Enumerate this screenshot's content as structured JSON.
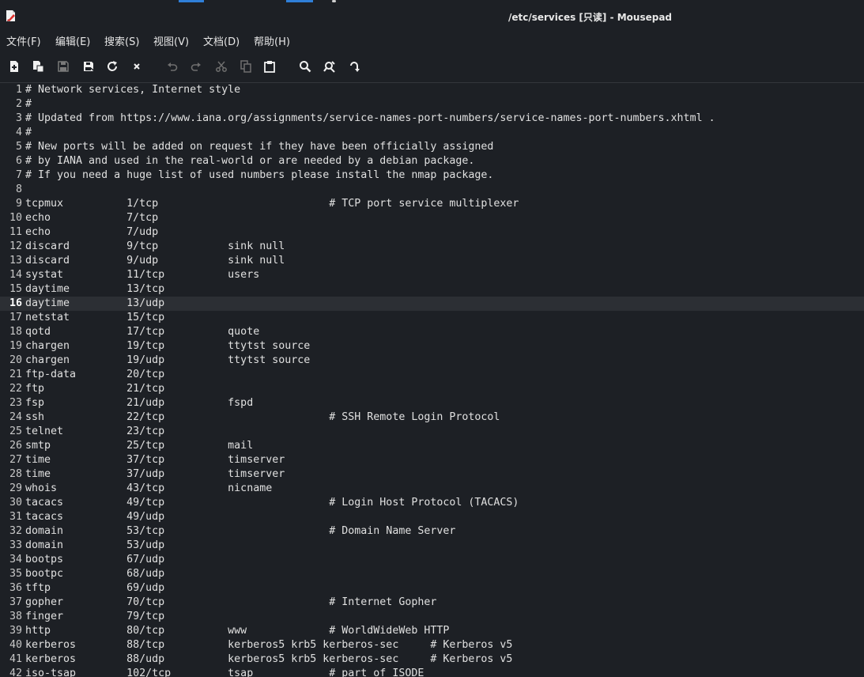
{
  "window": {
    "title": "/etc/services [只读] - Mousepad"
  },
  "menu": [
    {
      "label": "文件(F)"
    },
    {
      "label": "编辑(E)"
    },
    {
      "label": "搜索(S)"
    },
    {
      "label": "视图(V)"
    },
    {
      "label": "文档(D)"
    },
    {
      "label": "帮助(H)"
    }
  ],
  "toolbar": {
    "buttons": [
      {
        "icon": "new-document-icon"
      },
      {
        "icon": "new-window-icon"
      },
      {
        "icon": "save-icon"
      },
      {
        "icon": "save-as-icon"
      },
      {
        "icon": "reload-icon"
      },
      {
        "icon": "close-icon"
      },
      {
        "icon": "undo-icon"
      },
      {
        "icon": "redo-icon"
      },
      {
        "icon": "cut-icon"
      },
      {
        "icon": "copy-icon"
      },
      {
        "icon": "paste-icon"
      },
      {
        "icon": "search-icon"
      },
      {
        "icon": "find-replace-icon"
      },
      {
        "icon": "go-to-line-icon"
      }
    ]
  },
  "editor": {
    "current_line": 16,
    "lines": [
      {
        "n": "1",
        "text": "# Network services, Internet style"
      },
      {
        "n": "2",
        "text": "#"
      },
      {
        "n": "3",
        "text": "# Updated from https://www.iana.org/assignments/service-names-port-numbers/service-names-port-numbers.xhtml ."
      },
      {
        "n": "4",
        "text": "#"
      },
      {
        "n": "5",
        "text": "# New ports will be added on request if they have been officially assigned"
      },
      {
        "n": "6",
        "text": "# by IANA and used in the real-world or are needed by a debian package."
      },
      {
        "n": "7",
        "text": "# If you need a huge list of used numbers please install the nmap package."
      },
      {
        "n": "8",
        "text": ""
      },
      {
        "n": "9",
        "text": "tcpmux          1/tcp                           # TCP port service multiplexer"
      },
      {
        "n": "10",
        "text": "echo            7/tcp"
      },
      {
        "n": "11",
        "text": "echo            7/udp"
      },
      {
        "n": "12",
        "text": "discard         9/tcp           sink null"
      },
      {
        "n": "13",
        "text": "discard         9/udp           sink null"
      },
      {
        "n": "14",
        "text": "systat          11/tcp          users"
      },
      {
        "n": "15",
        "text": "daytime         13/tcp"
      },
      {
        "n": "16",
        "text": "daytime         13/udp"
      },
      {
        "n": "17",
        "text": "netstat         15/tcp"
      },
      {
        "n": "18",
        "text": "qotd            17/tcp          quote"
      },
      {
        "n": "19",
        "text": "chargen         19/tcp          ttytst source"
      },
      {
        "n": "20",
        "text": "chargen         19/udp          ttytst source"
      },
      {
        "n": "21",
        "text": "ftp-data        20/tcp"
      },
      {
        "n": "22",
        "text": "ftp             21/tcp"
      },
      {
        "n": "23",
        "text": "fsp             21/udp          fspd"
      },
      {
        "n": "24",
        "text": "ssh             22/tcp                          # SSH Remote Login Protocol"
      },
      {
        "n": "25",
        "text": "telnet          23/tcp"
      },
      {
        "n": "26",
        "text": "smtp            25/tcp          mail"
      },
      {
        "n": "27",
        "text": "time            37/tcp          timserver"
      },
      {
        "n": "28",
        "text": "time            37/udp          timserver"
      },
      {
        "n": "29",
        "text": "whois           43/tcp          nicname"
      },
      {
        "n": "30",
        "text": "tacacs          49/tcp                          # Login Host Protocol (TACACS)"
      },
      {
        "n": "31",
        "text": "tacacs          49/udp"
      },
      {
        "n": "32",
        "text": "domain          53/tcp                          # Domain Name Server"
      },
      {
        "n": "33",
        "text": "domain          53/udp"
      },
      {
        "n": "34",
        "text": "bootps          67/udp"
      },
      {
        "n": "35",
        "text": "bootpc          68/udp"
      },
      {
        "n": "36",
        "text": "tftp            69/udp"
      },
      {
        "n": "37",
        "text": "gopher          70/tcp                          # Internet Gopher"
      },
      {
        "n": "38",
        "text": "finger          79/tcp"
      },
      {
        "n": "39",
        "text": "http            80/tcp          www             # WorldWideWeb HTTP"
      },
      {
        "n": "40",
        "text": "kerberos        88/tcp          kerberos5 krb5 kerberos-sec     # Kerberos v5"
      },
      {
        "n": "41",
        "text": "kerberos        88/udp          kerberos5 krb5 kerberos-sec     # Kerberos v5"
      },
      {
        "n": "42",
        "text": "iso-tsap        102/tcp         tsap            # part of ISODE"
      }
    ]
  }
}
